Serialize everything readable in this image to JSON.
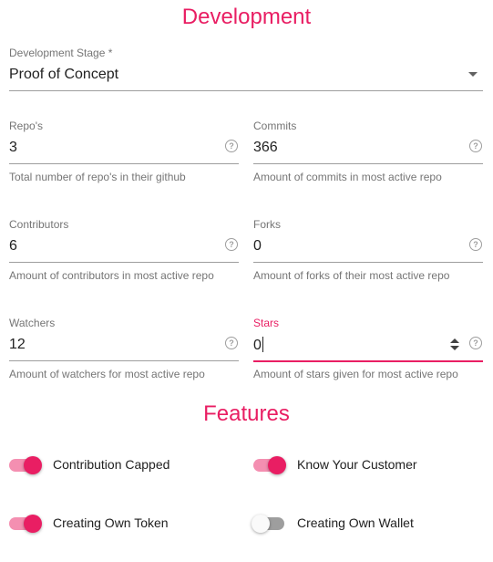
{
  "development": {
    "title": "Development",
    "stage": {
      "label": "Development Stage *",
      "value": "Proof of Concept"
    },
    "fields": {
      "repos": {
        "label": "Repo's",
        "value": "3",
        "helper": "Total number of repo's in their github"
      },
      "commits": {
        "label": "Commits",
        "value": "366",
        "helper": "Amount of commits in most active repo"
      },
      "contributors": {
        "label": "Contributors",
        "value": "6",
        "helper": "Amount of contributors in most active repo"
      },
      "forks": {
        "label": "Forks",
        "value": "0",
        "helper": "Amount of forks of their most active repo"
      },
      "watchers": {
        "label": "Watchers",
        "value": "12",
        "helper": "Amount of watchers for most active repo"
      },
      "stars": {
        "label": "Stars",
        "value": "0",
        "helper": "Amount of stars given for most active repo"
      }
    },
    "help_icon_glyph": "?"
  },
  "features": {
    "title": "Features",
    "toggles": {
      "contribution_capped": {
        "label": "Contribution Capped",
        "on": true
      },
      "know_your_customer": {
        "label": "Know Your Customer",
        "on": true
      },
      "creating_own_token": {
        "label": "Creating Own Token",
        "on": true
      },
      "creating_own_wallet": {
        "label": "Creating Own Wallet",
        "on": false
      }
    }
  },
  "colors": {
    "accent": "#e91e63",
    "accent_light": "#f48fb1",
    "label_gray": "#757575",
    "underline_gray": "#9e9e9e"
  },
  "icons": [
    "help-circle-icon",
    "dropdown-arrow-icon",
    "number-spinner-icon"
  ]
}
